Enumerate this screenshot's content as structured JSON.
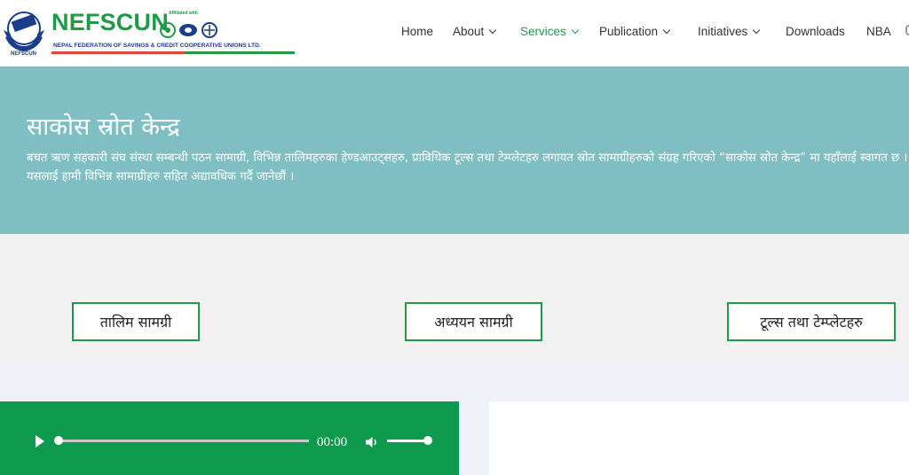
{
  "logo": {
    "name": "NEFSCUN",
    "full_name": "NEPAL FEDERATION OF SAVINGS & CREDIT COOPERATIVE UNIONS LTD.",
    "emblem_caption": "NEFSCUN",
    "affiliated_label": "Affiliated with"
  },
  "nav": {
    "items": [
      {
        "label": "Home",
        "dropdown": false
      },
      {
        "label": "About",
        "dropdown": true
      },
      {
        "label": "Services",
        "dropdown": true,
        "active": true
      },
      {
        "label": "Publication",
        "dropdown": true
      },
      {
        "label": "Initiatives",
        "dropdown": true
      },
      {
        "label": "Downloads",
        "dropdown": false
      },
      {
        "label": "NBA",
        "dropdown": false
      }
    ]
  },
  "hero": {
    "title": "साकोस स्रोत केन्द्र",
    "text": "बचत ऋण सहकारी संघ संस्था सम्बन्धी पठन सामाग्री, विभिन्न तालिमहरुका हेण्डआउट्सहरु, प्राविधिक टूल्स तथा टेम्प्लेटहरु लगायत स्रोत सामाग्रीहरुको संग्रह गरिएको “साकोस स्रोत केन्द्र” मा यहाँलाई स्वागत छ । यसलाई हामी विभिन्न सामाग्रीहरु सहित अद्यावधिक गर्दै जानेछौं ।"
  },
  "categories": [
    {
      "label": "तालिम सामग्री"
    },
    {
      "label": "अध्ययन सामग्री"
    },
    {
      "label": "टूल्स तथा टेम्प्लेटहरु"
    }
  ],
  "player": {
    "time": "00:00",
    "progress": 0,
    "volume": 1.0
  },
  "colors": {
    "brand_green": "#1d9b47",
    "brand_blue": "#1a3e8c",
    "hero_bg": "#7fbfc4",
    "player_bg": "#0e9a4c"
  }
}
